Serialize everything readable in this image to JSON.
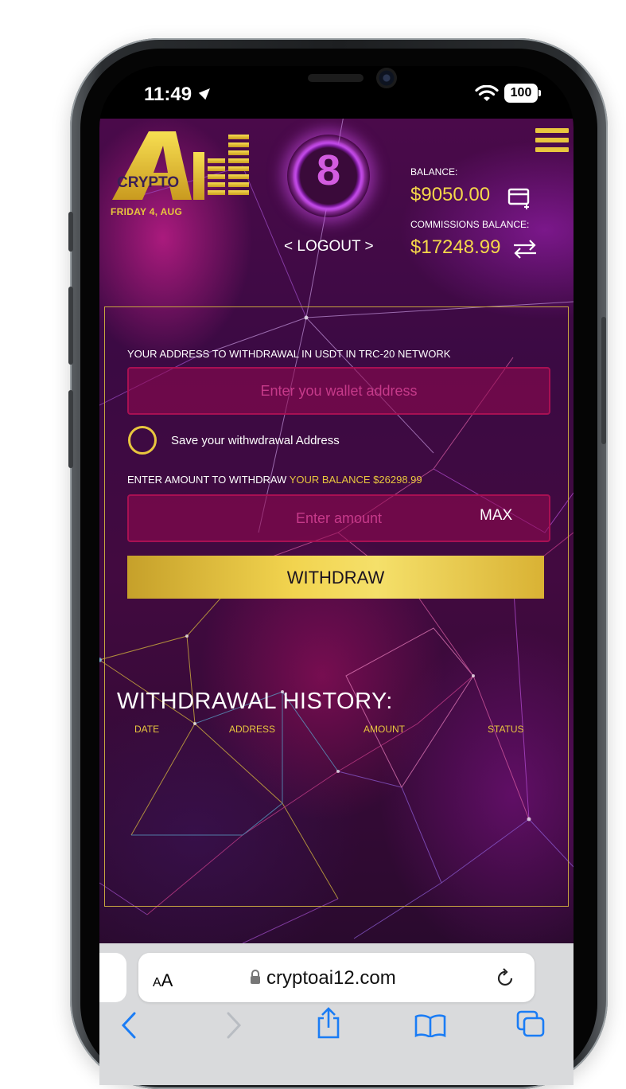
{
  "status_bar": {
    "time": "11:49",
    "battery": "100"
  },
  "app": {
    "logo_text": "CRYPTO",
    "date": "FRIDAY 4, AUG",
    "level": "8",
    "logout": "< LOGOUT >",
    "balance_label": "BALANCE:",
    "balance_value": "$9050.00",
    "commissions_label": "COMMISSIONS BALANCE:",
    "commissions_value": "$17248.99",
    "icons": [
      "menu-icon",
      "add-card-icon",
      "swap-icon"
    ],
    "accent_color": "#e8c63e"
  },
  "withdraw_form": {
    "address_label": "YOUR ADDRESS TO WITHDRAWAL IN USDT IN TRC-20 NETWORK",
    "address_placeholder": "Enter you wallet address",
    "save_address_label": "Save your withwdrawal Address",
    "amount_label": "ENTER AMOUNT TO WITHDRAW",
    "your_balance_label": "YOUR BALANCE $26298.99",
    "amount_placeholder": "Enter amount",
    "max_label": "MAX",
    "withdraw_label": "WITHDRAW"
  },
  "history": {
    "title": "WITHDRAWAL HISTORY:",
    "columns": [
      "DATE",
      "ADDRESS",
      "AMOUNT",
      "STATUS"
    ]
  },
  "browser": {
    "text_size_label_small": "A",
    "text_size_label_large": "A",
    "domain": "cryptoai12.com"
  }
}
